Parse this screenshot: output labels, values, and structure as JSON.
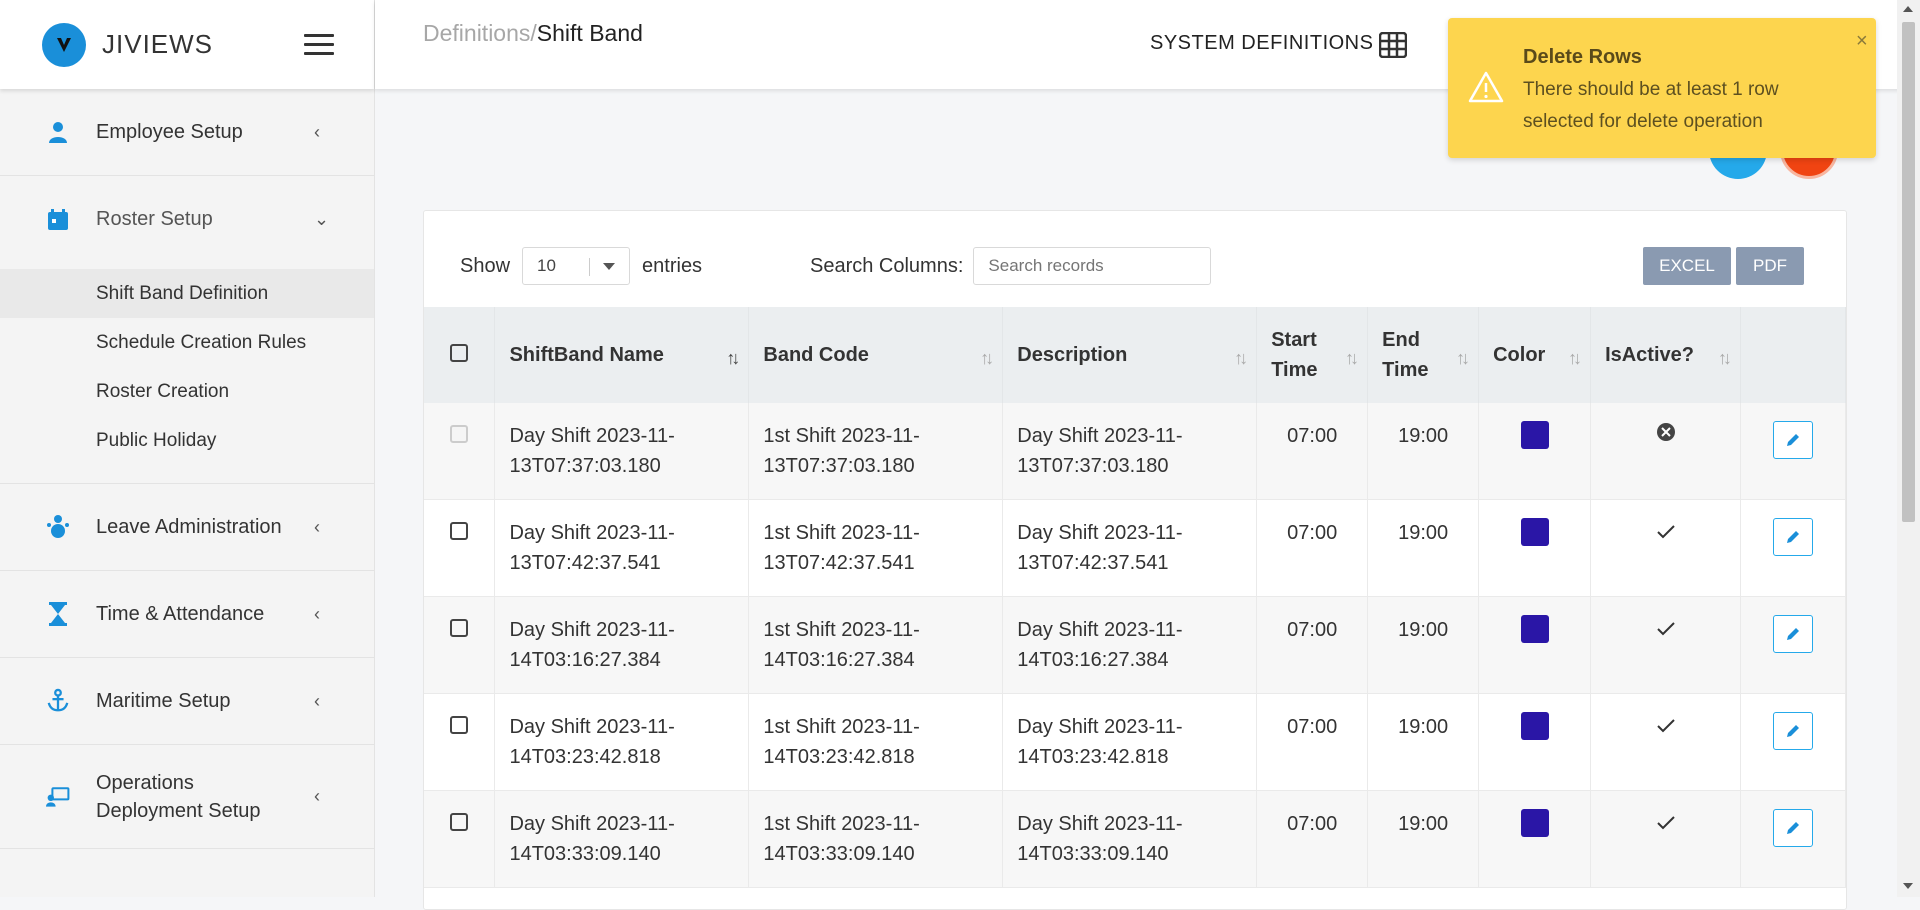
{
  "brand": {
    "name": "JIVIEWS"
  },
  "sidebar": {
    "items": [
      {
        "label": "Employee Setup",
        "icon": "employee-icon",
        "chevron": "‹"
      },
      {
        "label": "Roster Setup",
        "icon": "calendar-icon",
        "chevron": "⌄"
      },
      {
        "label": "Leave Administration",
        "icon": "leave-icon",
        "chevron": "‹"
      },
      {
        "label": "Time & Attendance",
        "icon": "hourglass-icon",
        "chevron": "‹"
      },
      {
        "label": "Maritime Setup",
        "icon": "anchor-icon",
        "chevron": "‹"
      },
      {
        "label": "Operations Deployment Setup",
        "icon": "deployment-icon",
        "chevron": "‹"
      }
    ],
    "roster_sub": [
      "Shift Band Definition",
      "Schedule Creation Rules",
      "Roster Creation",
      "Public Holiday"
    ]
  },
  "header": {
    "crumb_parent": "Definitions/",
    "crumb_current": "Shift Band",
    "system_definitions": "SYSTEM DEFINITIONS"
  },
  "toast": {
    "title": "Delete Rows",
    "message": "There should be at least 1 row selected for delete operation",
    "close": "×"
  },
  "controls": {
    "show": "Show",
    "entries_value": "10",
    "entries": "entries",
    "search_label": "Search Columns:",
    "search_placeholder": "Search records",
    "excel": "EXCEL",
    "pdf": "PDF"
  },
  "table": {
    "columns": [
      "ShiftBand Name",
      "Band Code",
      "Description",
      "Start Time",
      "End Time",
      "Color",
      "IsActive?"
    ],
    "rows": [
      {
        "name": "Day Shift 2023-11-13T07:37:03.180",
        "code": "1st Shift 2023-11-13T07:37:03.180",
        "desc": "Day Shift 2023-11-13T07:37:03.180",
        "start": "07:00",
        "end": "19:00",
        "color": "#2a16a6",
        "active": false
      },
      {
        "name": "Day Shift 2023-11-13T07:42:37.541",
        "code": "1st Shift 2023-11-13T07:42:37.541",
        "desc": "Day Shift 2023-11-13T07:42:37.541",
        "start": "07:00",
        "end": "19:00",
        "color": "#2a16a6",
        "active": true
      },
      {
        "name": "Day Shift 2023-11-14T03:16:27.384",
        "code": "1st Shift 2023-11-14T03:16:27.384",
        "desc": "Day Shift 2023-11-14T03:16:27.384",
        "start": "07:00",
        "end": "19:00",
        "color": "#2a16a6",
        "active": true
      },
      {
        "name": "Day Shift 2023-11-14T03:23:42.818",
        "code": "1st Shift 2023-11-14T03:23:42.818",
        "desc": "Day Shift 2023-11-14T03:23:42.818",
        "start": "07:00",
        "end": "19:00",
        "color": "#2a16a6",
        "active": true
      },
      {
        "name": "Day Shift 2023-11-14T03:33:09.140",
        "code": "1st Shift 2023-11-14T03:33:09.140",
        "desc": "Day Shift 2023-11-14T03:33:09.140",
        "start": "07:00",
        "end": "19:00",
        "color": "#2a16a6",
        "active": true
      }
    ]
  },
  "colors": {
    "accent": "#25a9ea",
    "danger": "#f04412",
    "toast": "#fdd54e",
    "swatch": "#2a16a6"
  }
}
